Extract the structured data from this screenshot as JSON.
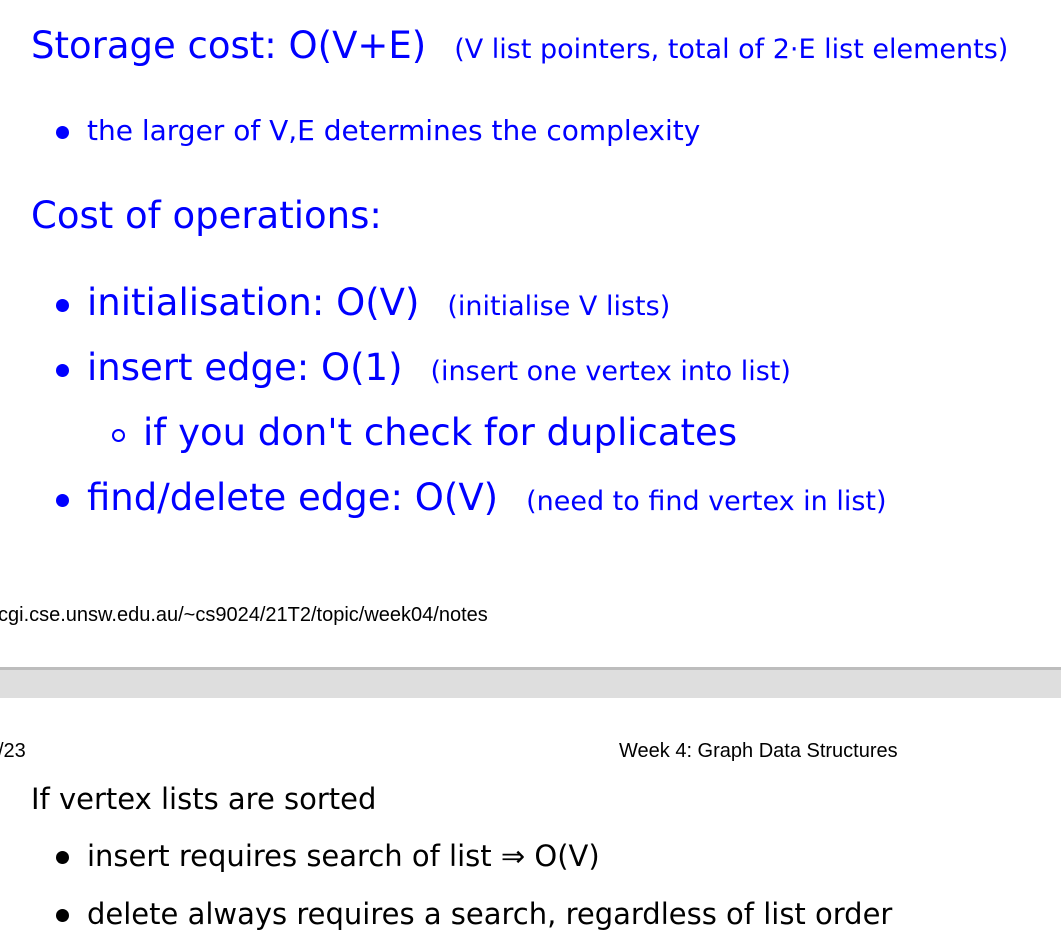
{
  "slide1": {
    "storage_heading": "Storage cost: O(V+E)",
    "storage_note": "(V list pointers, total of 2·E list elements)",
    "storage_bullet": "the larger of V,E determines the complexity",
    "ops_heading": "Cost of operations:",
    "ops": [
      {
        "label": "initialisation: O(V)",
        "note": "(initialise V lists)"
      },
      {
        "label": "insert edge: O(1)",
        "note": "(insert one vertex into list)"
      },
      {
        "label": "find/delete edge: O(V)",
        "note": "(need to find vertex in list)"
      }
    ],
    "ops_sub": "if you don't check for duplicates"
  },
  "footer": {
    "url": "cgi.cse.unsw.edu.au/~cs9024/21T2/topic/week04/notes"
  },
  "slide2": {
    "page_number": "/23",
    "page_title": "Week 4: Graph Data Structures",
    "intro": "If vertex lists are sorted",
    "bullets": [
      "insert requires search of list ⇒ O(V)",
      "delete always requires a search, regardless of list order"
    ]
  }
}
